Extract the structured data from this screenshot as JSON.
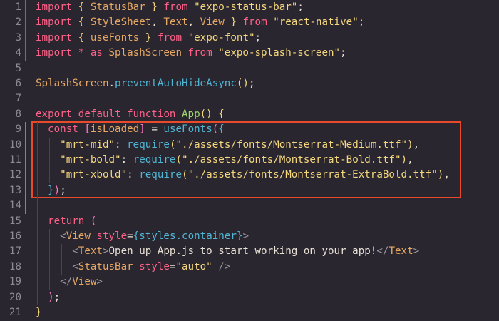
{
  "lines": [
    {
      "n": "1",
      "tokens": [
        {
          "t": "import ",
          "c": "kw2"
        },
        {
          "t": "{ ",
          "c": "bracket-yellow"
        },
        {
          "t": "StatusBar",
          "c": "cls"
        },
        {
          "t": " }",
          "c": "bracket-yellow"
        },
        {
          "t": " from ",
          "c": "kw2"
        },
        {
          "t": "\"expo-status-bar\"",
          "c": "str"
        },
        {
          "t": ";",
          "c": "plain"
        }
      ]
    },
    {
      "n": "2",
      "tokens": [
        {
          "t": "import ",
          "c": "kw2"
        },
        {
          "t": "{ ",
          "c": "bracket-yellow"
        },
        {
          "t": "StyleSheet",
          "c": "cls"
        },
        {
          "t": ", ",
          "c": "plain"
        },
        {
          "t": "Text",
          "c": "cls"
        },
        {
          "t": ", ",
          "c": "plain"
        },
        {
          "t": "View",
          "c": "cls"
        },
        {
          "t": " }",
          "c": "bracket-yellow"
        },
        {
          "t": " from ",
          "c": "kw2"
        },
        {
          "t": "\"react-native\"",
          "c": "str"
        },
        {
          "t": ";",
          "c": "plain"
        }
      ]
    },
    {
      "n": "3",
      "tokens": [
        {
          "t": "import ",
          "c": "kw2"
        },
        {
          "t": "{ ",
          "c": "bracket-yellow"
        },
        {
          "t": "useFonts",
          "c": "cls"
        },
        {
          "t": " }",
          "c": "bracket-yellow"
        },
        {
          "t": " from ",
          "c": "kw2"
        },
        {
          "t": "\"expo-font\"",
          "c": "str"
        },
        {
          "t": ";",
          "c": "plain"
        }
      ]
    },
    {
      "n": "4",
      "tokens": [
        {
          "t": "import ",
          "c": "kw2"
        },
        {
          "t": "* ",
          "c": "kw2"
        },
        {
          "t": "as ",
          "c": "kw2"
        },
        {
          "t": "SplashScreen",
          "c": "cls"
        },
        {
          "t": " from ",
          "c": "kw2"
        },
        {
          "t": "\"expo-splash-screen\"",
          "c": "str"
        },
        {
          "t": ";",
          "c": "plain"
        }
      ]
    },
    {
      "n": "5",
      "tokens": []
    },
    {
      "n": "6",
      "tokens": [
        {
          "t": "SplashScreen",
          "c": "cls"
        },
        {
          "t": ".",
          "c": "plain"
        },
        {
          "t": "preventAutoHideAsync",
          "c": "method"
        },
        {
          "t": "()",
          "c": "bracket-yellow"
        },
        {
          "t": ";",
          "c": "plain"
        }
      ]
    },
    {
      "n": "7",
      "tokens": []
    },
    {
      "n": "8",
      "tokens": [
        {
          "t": "export ",
          "c": "kw2"
        },
        {
          "t": "default ",
          "c": "kw2"
        },
        {
          "t": "function ",
          "c": "kw2"
        },
        {
          "t": "App",
          "c": "fn"
        },
        {
          "t": "() ",
          "c": "bracket-yellow"
        },
        {
          "t": "{",
          "c": "bracket-yellow"
        }
      ]
    },
    {
      "n": "9",
      "tokens": [
        {
          "t": "  const ",
          "c": "kw2"
        },
        {
          "t": "[",
          "c": "bracket-pink"
        },
        {
          "t": "isLoaded",
          "c": "cls"
        },
        {
          "t": "]",
          "c": "bracket-pink"
        },
        {
          "t": " = ",
          "c": "plain"
        },
        {
          "t": "useFonts",
          "c": "method"
        },
        {
          "t": "(",
          "c": "bracket-pink"
        },
        {
          "t": "{",
          "c": "method"
        }
      ]
    },
    {
      "n": "10",
      "tokens": [
        {
          "t": "    \"mrt-mid\"",
          "c": "str"
        },
        {
          "t": ": ",
          "c": "plain"
        },
        {
          "t": "require",
          "c": "method"
        },
        {
          "t": "(",
          "c": "bracket-yellow"
        },
        {
          "t": "\"./assets/fonts/Montserrat-Medium.ttf\"",
          "c": "str"
        },
        {
          "t": ")",
          "c": "bracket-yellow"
        },
        {
          "t": ",",
          "c": "plain"
        }
      ]
    },
    {
      "n": "11",
      "tokens": [
        {
          "t": "    \"mrt-bold\"",
          "c": "str"
        },
        {
          "t": ": ",
          "c": "plain"
        },
        {
          "t": "require",
          "c": "method"
        },
        {
          "t": "(",
          "c": "bracket-yellow"
        },
        {
          "t": "\"./assets/fonts/Montserrat-Bold.ttf\"",
          "c": "str"
        },
        {
          "t": ")",
          "c": "bracket-yellow"
        },
        {
          "t": ",",
          "c": "plain"
        }
      ]
    },
    {
      "n": "12",
      "tokens": [
        {
          "t": "    \"mrt-xbold\"",
          "c": "str"
        },
        {
          "t": ": ",
          "c": "plain"
        },
        {
          "t": "require",
          "c": "method"
        },
        {
          "t": "(",
          "c": "bracket-yellow"
        },
        {
          "t": "\"./assets/fonts/Montserrat-ExtraBold.ttf\"",
          "c": "str"
        },
        {
          "t": ")",
          "c": "bracket-yellow"
        },
        {
          "t": ",",
          "c": "plain"
        }
      ]
    },
    {
      "n": "13",
      "tokens": [
        {
          "t": "  ",
          "c": "plain"
        },
        {
          "t": "}",
          "c": "method"
        },
        {
          "t": ")",
          "c": "bracket-pink"
        },
        {
          "t": ";",
          "c": "plain"
        }
      ]
    },
    {
      "n": "14",
      "tokens": []
    },
    {
      "n": "15",
      "tokens": [
        {
          "t": "  return ",
          "c": "kw2"
        },
        {
          "t": "(",
          "c": "bracket-pink"
        }
      ]
    },
    {
      "n": "16",
      "tokens": [
        {
          "t": "    <",
          "c": "punct"
        },
        {
          "t": "View",
          "c": "cls"
        },
        {
          "t": " style",
          "c": "kw2"
        },
        {
          "t": "=",
          "c": "plain"
        },
        {
          "t": "{",
          "c": "method"
        },
        {
          "t": "styles.container",
          "c": "method"
        },
        {
          "t": "}",
          "c": "method"
        },
        {
          "t": ">",
          "c": "punct"
        }
      ]
    },
    {
      "n": "17",
      "tokens": [
        {
          "t": "      <",
          "c": "punct"
        },
        {
          "t": "Text",
          "c": "cls"
        },
        {
          "t": ">",
          "c": "punct"
        },
        {
          "t": "Open up App.js to start working on your app!",
          "c": "plain"
        },
        {
          "t": "</",
          "c": "punct"
        },
        {
          "t": "Text",
          "c": "cls"
        },
        {
          "t": ">",
          "c": "punct"
        }
      ]
    },
    {
      "n": "18",
      "tokens": [
        {
          "t": "      <",
          "c": "punct"
        },
        {
          "t": "StatusBar",
          "c": "cls"
        },
        {
          "t": " style",
          "c": "kw2"
        },
        {
          "t": "=",
          "c": "plain"
        },
        {
          "t": "\"auto\"",
          "c": "str"
        },
        {
          "t": " />",
          "c": "punct"
        }
      ]
    },
    {
      "n": "19",
      "tokens": [
        {
          "t": "    </",
          "c": "punct"
        },
        {
          "t": "View",
          "c": "cls"
        },
        {
          "t": ">",
          "c": "punct"
        }
      ]
    },
    {
      "n": "20",
      "tokens": [
        {
          "t": "  ",
          "c": "plain"
        },
        {
          "t": ")",
          "c": "bracket-pink"
        },
        {
          "t": ";",
          "c": "plain"
        }
      ]
    },
    {
      "n": "21",
      "tokens": [
        {
          "t": "}",
          "c": "bracket-yellow"
        }
      ]
    }
  ],
  "colors": {
    "background": "#2a2630",
    "highlight_border": "#e84a2b",
    "modified_blue": "#3b7cc7",
    "modified_green": "#6f9d3f"
  }
}
